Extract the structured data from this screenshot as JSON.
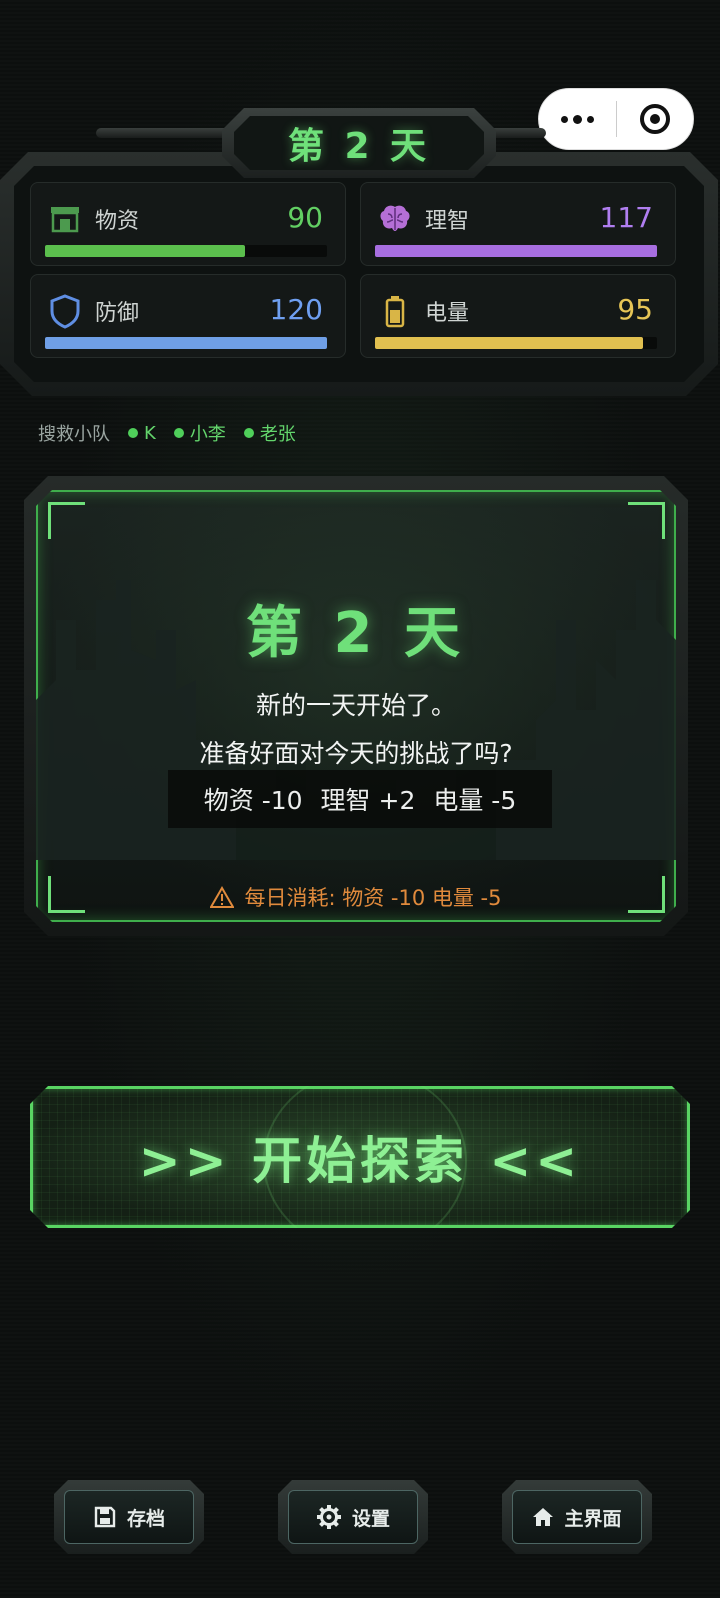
{
  "day_title": "第 2 天",
  "stats": {
    "supplies": {
      "label": "物资",
      "value": "90",
      "fraction": 0.71,
      "color": "#5bbf4d",
      "icon": "store-icon"
    },
    "sanity": {
      "label": "理智",
      "value": "117",
      "fraction": 1.0,
      "color": "#a76ee0",
      "icon": "brain-icon"
    },
    "defense": {
      "label": "防御",
      "value": "120",
      "fraction": 1.0,
      "color": "#6f9fe6",
      "icon": "shield-icon"
    },
    "power": {
      "label": "电量",
      "value": "95",
      "fraction": 0.95,
      "color": "#e1c050",
      "icon": "battery-icon"
    }
  },
  "team": {
    "label": "搜救小队",
    "members": [
      "K",
      "小李",
      "老张"
    ]
  },
  "event": {
    "title": "第 2 天",
    "line1": "新的一天开始了。",
    "line2": "准备好面对今天的挑战了吗?",
    "effects": [
      "物资 -10",
      "理智 +2",
      "电量 -5"
    ],
    "warning": "每日消耗: 物资 -10  电量 -5"
  },
  "explore_button": {
    "label": ">> 开始探索 <<"
  },
  "bottom_bar": {
    "save": {
      "label": "存档",
      "icon": "floppy-disk-icon"
    },
    "settings": {
      "label": "设置",
      "icon": "gear-icon"
    },
    "home": {
      "label": "主界面",
      "icon": "home-icon"
    }
  }
}
